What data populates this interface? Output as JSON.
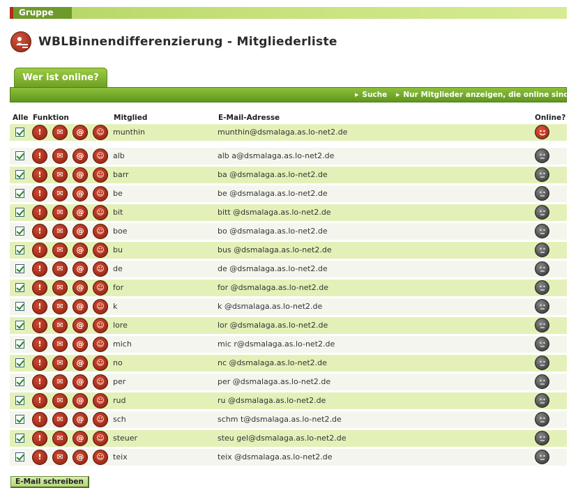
{
  "group": {
    "label": "Gruppe"
  },
  "page": {
    "title": "WBLBinnendifferenzierung - Mitgliederliste"
  },
  "tabs": [
    {
      "label": "Wer ist online?"
    }
  ],
  "actions": {
    "search": "Suche",
    "online_only": "Nur Mitglieder anzeigen, die online sind"
  },
  "columns": {
    "all": "Alle",
    "function": "Funktion",
    "member": "Mitglied",
    "email": "E-Mail-Adresse",
    "online": "Online?"
  },
  "members": [
    {
      "name": "munthin",
      "email": "munthin@dsmalaga.as.lo-net2.de",
      "online": true
    },
    {
      "name": "alb",
      "email": "alb      a@dsmalaga.as.lo-net2.de",
      "online": false
    },
    {
      "name": "barr",
      "email": "ba      @dsmalaga.as.lo-net2.de",
      "online": false
    },
    {
      "name": "be",
      "email": "be     @dsmalaga.as.lo-net2.de",
      "online": false
    },
    {
      "name": "bit",
      "email": "bitt     @dsmalaga.as.lo-net2.de",
      "online": false
    },
    {
      "name": "boe",
      "email": "bo      @dsmalaga.as.lo-net2.de",
      "online": false
    },
    {
      "name": "bu",
      "email": "bus     @dsmalaga.as.lo-net2.de",
      "online": false
    },
    {
      "name": "de",
      "email": "de     @dsmalaga.as.lo-net2.de",
      "online": false
    },
    {
      "name": "for",
      "email": "for      @dsmalaga.as.lo-net2.de",
      "online": false
    },
    {
      "name": "k",
      "email": "k      @dsmalaga.as.lo-net2.de",
      "online": false
    },
    {
      "name": "lore",
      "email": "lor      @dsmalaga.as.lo-net2.de",
      "online": false
    },
    {
      "name": "mich",
      "email": "mic     r@dsmalaga.as.lo-net2.de",
      "online": false
    },
    {
      "name": "no",
      "email": "nc      @dsmalaga.as.lo-net2.de",
      "online": false
    },
    {
      "name": "per",
      "email": "per      @dsmalaga.as.lo-net2.de",
      "online": false
    },
    {
      "name": "rud",
      "email": "ru      @dsmalaga.as.lo-net2.de",
      "online": false
    },
    {
      "name": "sch",
      "email": "schm    t@dsmalaga.as.lo-net2.de",
      "online": false
    },
    {
      "name": "steuer",
      "email": "steu      gel@dsmalaga.as.lo-net2.de",
      "online": false
    },
    {
      "name": "teix",
      "email": "teix      @dsmalaga.as.lo-net2.de",
      "online": false
    }
  ],
  "footer": {
    "mail_button": "E-Mail schreiben"
  },
  "colors": {
    "accent_green": "#6fa026",
    "row_green": "#e3f1b8",
    "row_light": "#f4f6ee",
    "button_red": "#a82a14"
  },
  "icons": {
    "row_functions": [
      "profile-icon",
      "mail-icon",
      "at-icon",
      "smiley-icon"
    ],
    "online": "smiley-happy-icon",
    "offline": "smiley-neutral-icon"
  }
}
